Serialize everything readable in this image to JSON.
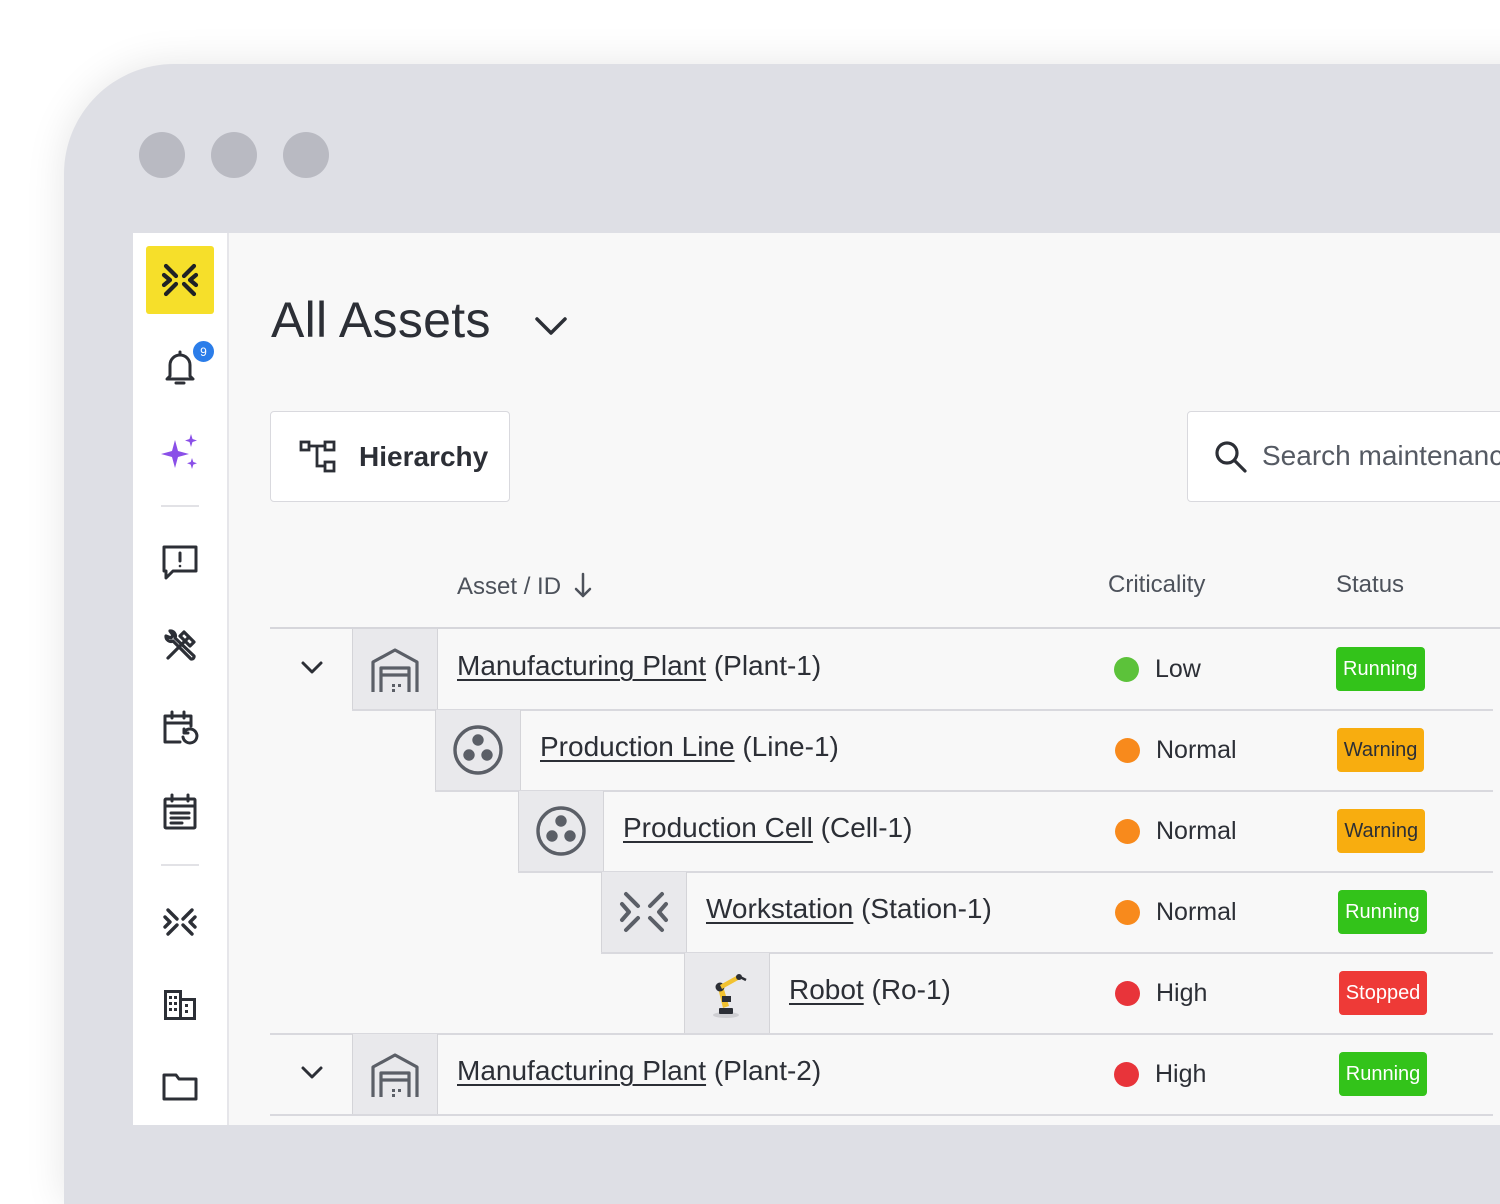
{
  "page": {
    "title": "All Assets",
    "notification_count": "9",
    "hierarchy_label": "Hierarchy",
    "search_placeholder": "Search maintenance"
  },
  "table": {
    "columns": {
      "asset": "Asset / ID",
      "criticality": "Criticality",
      "status": "Status"
    },
    "rows": [
      {
        "name": "Manufacturing Plant",
        "id": "(Plant-1)",
        "icon": "building-icon",
        "criticality": "Low",
        "crit_color": "#5cc23a",
        "status": "Running",
        "status_bg": "#33c31a",
        "status_fg": "#ffffff",
        "expandable": true
      },
      {
        "name": "Production Line",
        "id": "(Line-1)",
        "icon": "line-cluster-icon",
        "criticality": "Normal",
        "crit_color": "#f88a1c",
        "status": "Warning",
        "status_bg": "#f8ad0f",
        "status_fg": "#2c2f36",
        "expandable": false
      },
      {
        "name": "Production Cell",
        "id": "(Cell-1)",
        "icon": "cell-cluster-icon",
        "criticality": "Normal",
        "crit_color": "#f88a1c",
        "status": "Warning",
        "status_bg": "#f8ad0f",
        "status_fg": "#2c2f36",
        "expandable": false
      },
      {
        "name": "Workstation",
        "id": "(Station-1)",
        "icon": "workstation-icon",
        "criticality": "Normal",
        "crit_color": "#f88a1c",
        "status": "Running",
        "status_bg": "#33c31a",
        "status_fg": "#ffffff",
        "expandable": false
      },
      {
        "name": "Robot",
        "id": "(Ro-1)",
        "icon": "robot-arm-image",
        "criticality": "High",
        "crit_color": "#e8343a",
        "status": "Stopped",
        "status_bg": "#ee3a37",
        "status_fg": "#ffffff",
        "expandable": false
      },
      {
        "name": "Manufacturing Plant",
        "id": "(Plant-2)",
        "icon": "building-icon",
        "criticality": "High",
        "crit_color": "#e8343a",
        "status": "Running",
        "status_bg": "#33c31a",
        "status_fg": "#ffffff",
        "expandable": true
      }
    ]
  },
  "sidebar": {
    "icons": [
      "app-logo-icon",
      "bell-icon",
      "sparkle-icon",
      "message-alert-icon",
      "tools-icon",
      "calendar-refresh-icon",
      "calendar-list-icon",
      "asset-x-icon",
      "building-grid-icon",
      "folder-icon"
    ]
  }
}
